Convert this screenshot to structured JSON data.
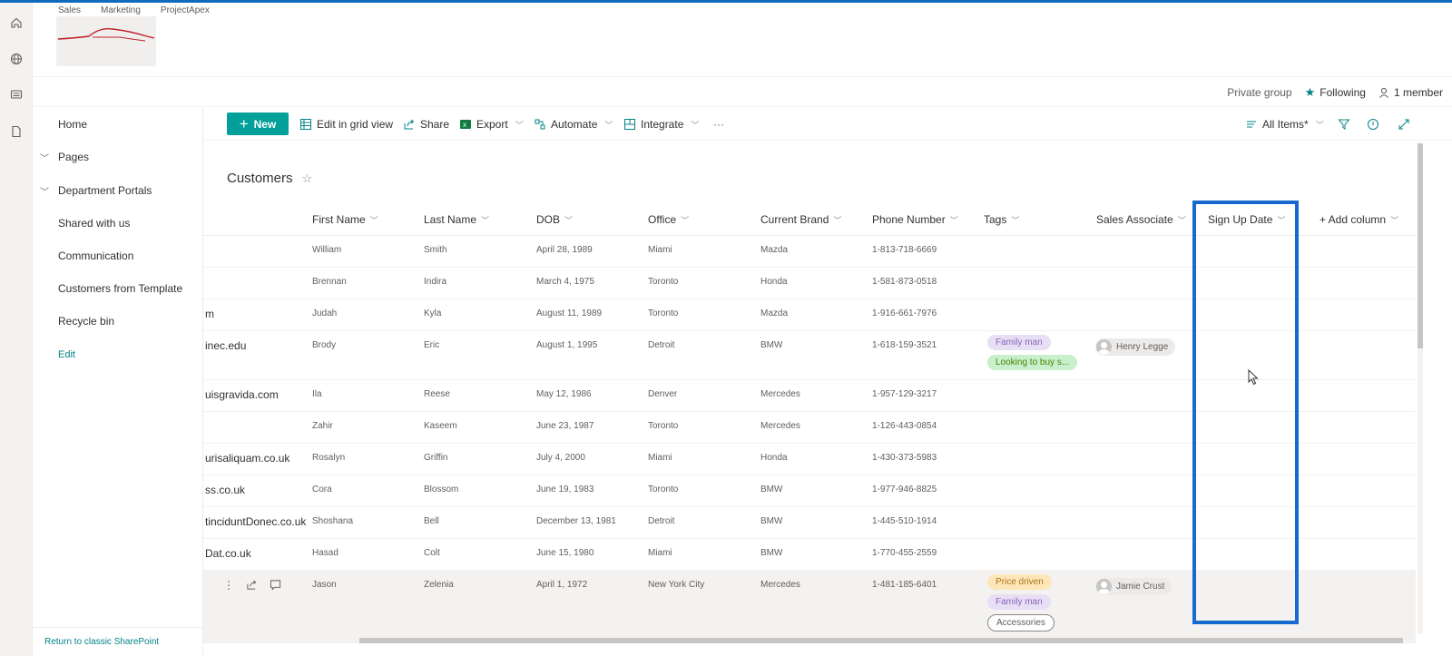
{
  "site_nav": [
    "Sales",
    "Marketing",
    "ProjectApex"
  ],
  "group_info": {
    "privacy": "Private group",
    "following": "Following",
    "members": "1 member"
  },
  "left_nav": {
    "items": [
      {
        "label": "Home",
        "expandable": false
      },
      {
        "label": "Pages",
        "expandable": true
      },
      {
        "label": "Department Portals",
        "expandable": true
      },
      {
        "label": "Shared with us",
        "expandable": false
      },
      {
        "label": "Communication",
        "expandable": false
      },
      {
        "label": "Customers from Template",
        "expandable": false
      },
      {
        "label": "Recycle bin",
        "expandable": false
      }
    ],
    "edit": "Edit",
    "return_link": "Return to classic SharePoint"
  },
  "command_bar": {
    "new": "New",
    "edit_grid": "Edit in grid view",
    "share": "Share",
    "export": "Export",
    "automate": "Automate",
    "integrate": "Integrate",
    "more": "···",
    "view": "All Items*"
  },
  "list": {
    "title": "Customers",
    "columns": [
      "First Name",
      "Last Name",
      "DOB",
      "Office",
      "Current Brand",
      "Phone Number",
      "Tags",
      "Sales Associate",
      "Sign Up Date",
      "+ Add column"
    ],
    "rows": [
      {
        "email": "",
        "first": "William",
        "last": "Smith",
        "dob": "April 28, 1989",
        "office": "Miami",
        "brand": "Mazda",
        "phone": "1-813-718-6669",
        "tags": [],
        "associate": ""
      },
      {
        "email": "",
        "first": "Brennan",
        "last": "Indira",
        "dob": "March 4, 1975",
        "office": "Toronto",
        "brand": "Honda",
        "phone": "1-581-873-0518",
        "tags": [],
        "associate": ""
      },
      {
        "email": "m",
        "first": "Judah",
        "last": "Kyla",
        "dob": "August 11, 1989",
        "office": "Toronto",
        "brand": "Mazda",
        "phone": "1-916-661-7976",
        "tags": [],
        "associate": ""
      },
      {
        "email": "inec.edu",
        "first": "Brody",
        "last": "Eric",
        "dob": "August 1, 1995",
        "office": "Detroit",
        "brand": "BMW",
        "phone": "1-618-159-3521",
        "tags": [
          {
            "label": "Family man",
            "color": "purple"
          },
          {
            "label": "Looking to buy s...",
            "color": "green"
          }
        ],
        "associate": "Henry Legge"
      },
      {
        "email": "uisgravida.com",
        "first": "Ila",
        "last": "Reese",
        "dob": "May 12, 1986",
        "office": "Denver",
        "brand": "Mercedes",
        "phone": "1-957-129-3217",
        "tags": [],
        "associate": ""
      },
      {
        "email": "",
        "first": "Zahir",
        "last": "Kaseem",
        "dob": "June 23, 1987",
        "office": "Toronto",
        "brand": "Mercedes",
        "phone": "1-126-443-0854",
        "tags": [],
        "associate": ""
      },
      {
        "email": "urisaliquam.co.uk",
        "first": "Rosalyn",
        "last": "Griffin",
        "dob": "July 4, 2000",
        "office": "Miami",
        "brand": "Honda",
        "phone": "1-430-373-5983",
        "tags": [],
        "associate": ""
      },
      {
        "email": "ss.co.uk",
        "first": "Cora",
        "last": "Blossom",
        "dob": "June 19, 1983",
        "office": "Toronto",
        "brand": "BMW",
        "phone": "1-977-946-8825",
        "tags": [],
        "associate": ""
      },
      {
        "email": "tinciduntDonec.co.uk",
        "first": "Shoshana",
        "last": "Bell",
        "dob": "December 13, 1981",
        "office": "Detroit",
        "brand": "BMW",
        "phone": "1-445-510-1914",
        "tags": [],
        "associate": ""
      },
      {
        "email": "Dat.co.uk",
        "first": "Hasad",
        "last": "Colt",
        "dob": "June 15, 1980",
        "office": "Miami",
        "brand": "BMW",
        "phone": "1-770-455-2559",
        "tags": [],
        "associate": ""
      },
      {
        "email": "",
        "first": "Jason",
        "last": "Zelenia",
        "dob": "April 1, 1972",
        "office": "New York City",
        "brand": "Mercedes",
        "phone": "1-481-185-6401",
        "tags": [
          {
            "label": "Price driven",
            "color": "yellow"
          },
          {
            "label": "Family man",
            "color": "purple"
          },
          {
            "label": "Accessories",
            "color": "outline"
          }
        ],
        "associate": "Jamie Crust",
        "selected": true
      }
    ]
  },
  "colors": {
    "accent": "#03a09a",
    "highlight_box": "#1769cf",
    "top_bar": "#0f6cbd"
  }
}
